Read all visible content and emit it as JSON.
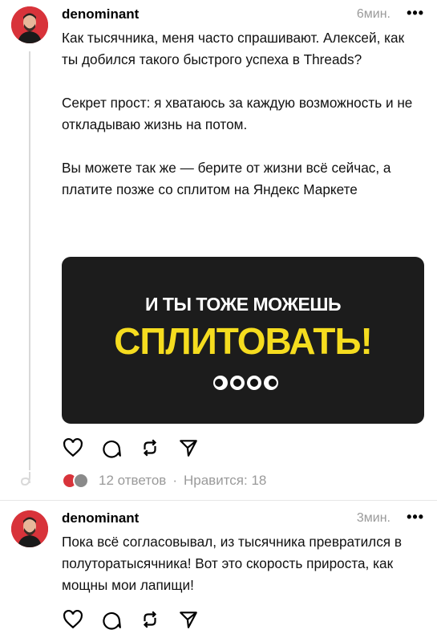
{
  "posts": [
    {
      "username": "denominant",
      "time": "6мин.",
      "more": "•••",
      "paragraphs": [
        "Как тысячника, меня часто спрашивают. Алексей, как ты добился такого быстрого успеха в Threads?",
        "Секрет прост: я хватаюсь за каждую возможность и не откладываю жизнь на потом.",
        "Вы можете так же — берите от жизни всё сейчас, а платите позже со сплитом на Яндекс Маркете"
      ],
      "banner": {
        "top_text": "И ТЫ ТОЖЕ МОЖЕШЬ",
        "main_text": "СПЛИТОВАТЬ!"
      },
      "actions": [
        "heart-icon",
        "comment-icon",
        "repost-icon",
        "share-icon"
      ],
      "stats": {
        "replies": "12 ответов",
        "separator": "·",
        "likes": "Нравится: 18"
      }
    },
    {
      "username": "denominant",
      "time": "3мин.",
      "more": "•••",
      "paragraphs": [
        "Пока всё согласовывал, из тысячника превратился в полуторатысячника! Вот это скорость прироста, как мощны мои лапищи!"
      ],
      "actions": [
        "heart-icon",
        "comment-icon",
        "repost-icon",
        "share-icon"
      ]
    }
  ],
  "colors": {
    "accent_yellow": "#f5dc1f",
    "avatar_red": "#d8333a",
    "muted_gray": "#9a9a9a",
    "banner_bg": "#1c1c1c"
  }
}
